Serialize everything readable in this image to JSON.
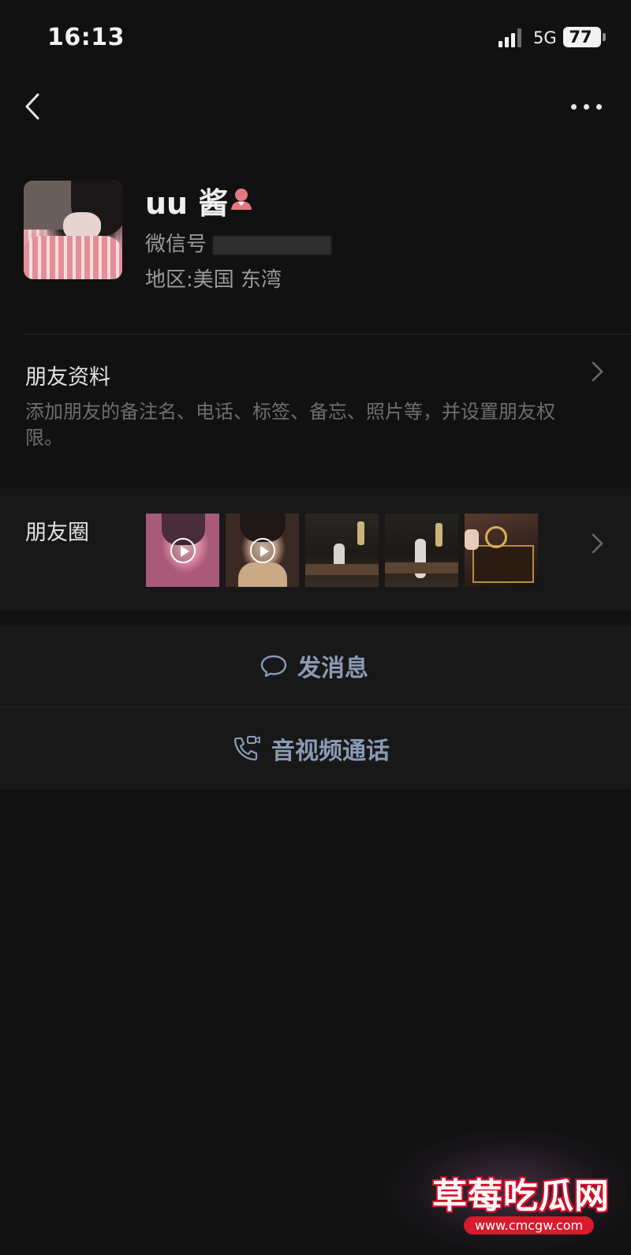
{
  "status_bar": {
    "time": "16:13",
    "network": "5G",
    "battery": "77"
  },
  "profile": {
    "nickname": "uu 酱",
    "wechat_id_label": "微信号",
    "region_label": "地区:",
    "region_value": "美国 东湾"
  },
  "friend_info": {
    "title": "朋友资料",
    "description": "添加朋友的备注名、电话、标签、备忘、照片等，并设置朋友权限。"
  },
  "moments": {
    "title": "朋友圈",
    "thumbnails": [
      {
        "kind": "video"
      },
      {
        "kind": "video"
      },
      {
        "kind": "photo"
      },
      {
        "kind": "photo"
      },
      {
        "kind": "photo"
      }
    ]
  },
  "actions": {
    "message_label": "发消息",
    "call_label": "音视频通话"
  },
  "watermark": {
    "title": "草莓吃瓜网",
    "url": "www.cmcgw.com"
  },
  "colors": {
    "background": "#111111",
    "cell": "#181818",
    "action_text": "#8a9ab6",
    "gender_icon": "#e5777e"
  }
}
